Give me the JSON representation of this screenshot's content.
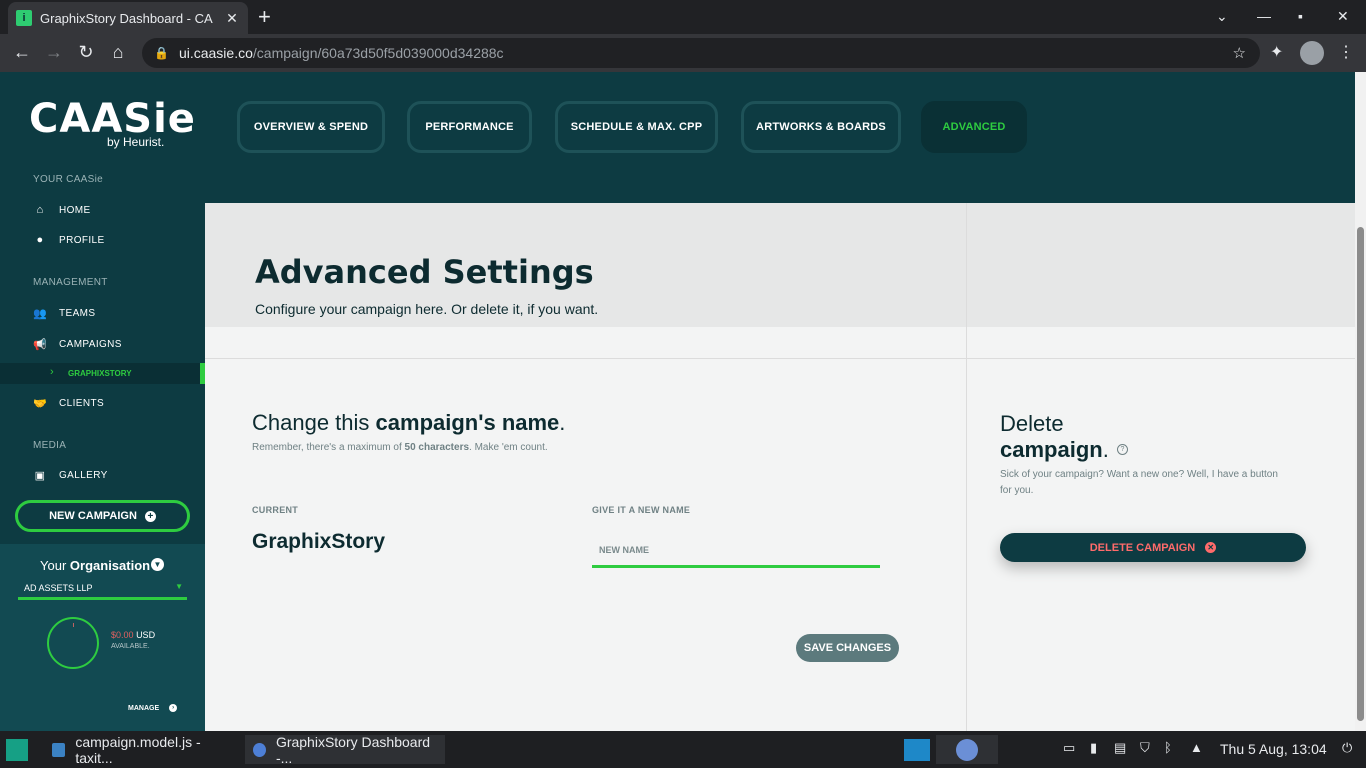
{
  "browser": {
    "tab_title": "GraphixStory Dashboard - CA",
    "url_host": "ui.caasie.co",
    "url_path": "/campaign/60a73d50f5d039000d34288c"
  },
  "sidebar": {
    "logo": "CAASie",
    "logo_sub": "by Heurist.",
    "section_your": "YOUR CAASie",
    "home": "HOME",
    "profile": "PROFILE",
    "section_management": "MANAGEMENT",
    "teams": "TEAMS",
    "campaigns": "CAMPAIGNS",
    "campaign_sub": "GRAPHIXSTORY",
    "clients": "CLIENTS",
    "section_media": "MEDIA",
    "gallery": "GALLERY",
    "new_campaign": "NEW CAMPAIGN"
  },
  "organisation": {
    "title_prefix": "Your",
    "title_bold": "Organisation",
    "selected": "AD ASSETS LLP",
    "balance_symbol": "$",
    "balance_amount": "0.00",
    "balance_currency": "USD",
    "available": "AVAILABLE.",
    "manage": "MANAGE"
  },
  "tabs": [
    {
      "label": "OVERVIEW & SPEND"
    },
    {
      "label": "PERFORMANCE"
    },
    {
      "label": "SCHEDULE & MAX. CPP"
    },
    {
      "label": "ARTWORKS & BOARDS"
    },
    {
      "label": "ADVANCED"
    }
  ],
  "header": {
    "title": "Advanced Settings",
    "subtitle": "Configure your campaign here. Or delete it, if you want."
  },
  "rename": {
    "title_prefix": "Change this",
    "title_bold": "campaign's name",
    "hint_prefix": "Remember, there's a maximum of",
    "hint_bold": "50 characters",
    "hint_suffix": ". Make 'em count.",
    "current_label": "CURRENT",
    "current_value": "GraphixStory",
    "new_label": "GIVE IT A NEW NAME",
    "new_placeholder": "NEW NAME",
    "save": "SAVE CHANGES"
  },
  "delete": {
    "title_line1": "Delete",
    "title_bold": "campaign",
    "desc": "Sick of your campaign? Want a new one? Well, I have a button for you.",
    "button": "DELETE CAMPAIGN"
  },
  "taskbar": {
    "item1": "campaign.model.js - taxit...",
    "item2": "GraphixStory Dashboard -...",
    "clock": "Thu 5 Aug, 13:04"
  }
}
